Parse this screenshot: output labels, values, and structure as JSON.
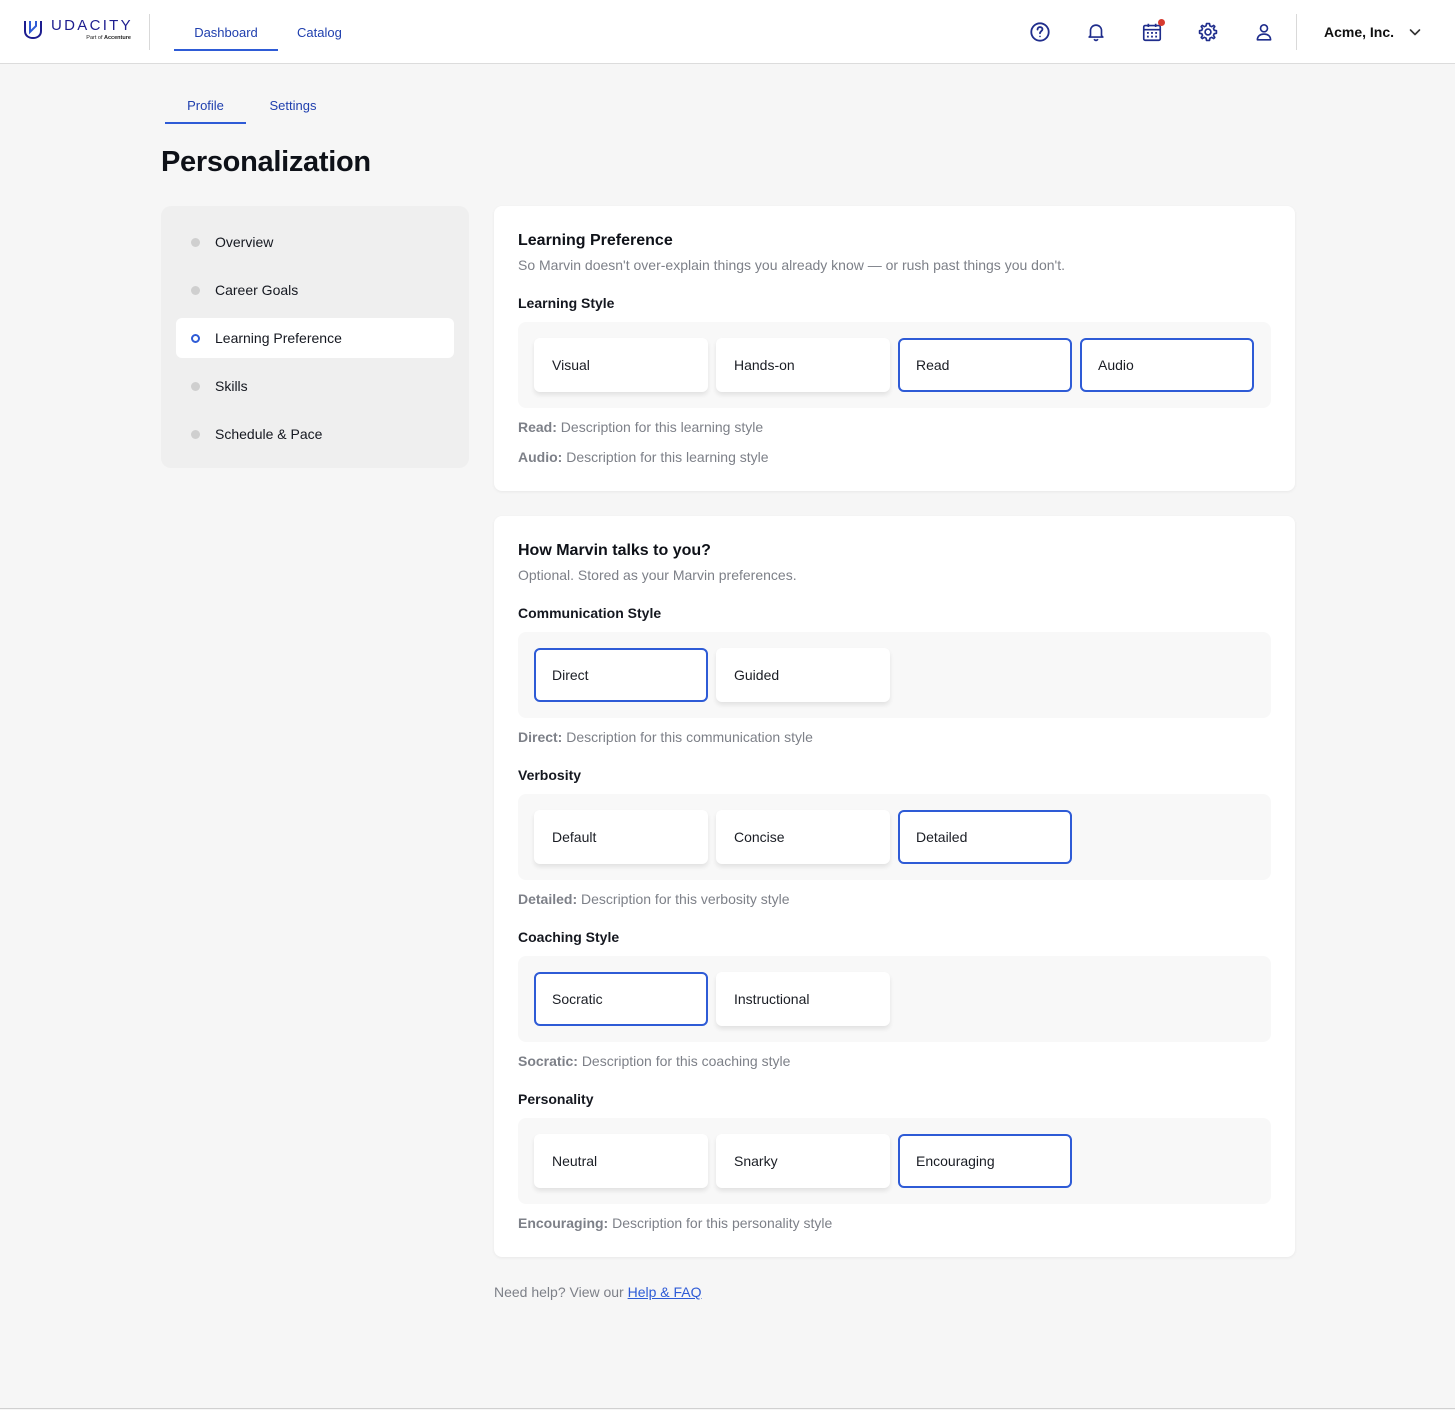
{
  "brand": {
    "name": "UDACITY",
    "sub_prefix": "Part of",
    "sub_company": "Accenture",
    "accent": "#2e5bd6"
  },
  "topnav": {
    "links": [
      {
        "label": "Dashboard",
        "active": true
      },
      {
        "label": "Catalog",
        "active": false
      }
    ],
    "icons": [
      "help-circle-icon",
      "bell-icon",
      "calendar-icon",
      "gear-icon",
      "user-icon"
    ],
    "org_name": "Acme, Inc."
  },
  "subtabs": [
    {
      "label": "Profile",
      "active": true
    },
    {
      "label": "Settings",
      "active": false
    }
  ],
  "page_title": "Personalization",
  "sidenav": {
    "items": [
      {
        "label": "Overview",
        "active": false
      },
      {
        "label": "Career Goals",
        "active": false
      },
      {
        "label": "Learning Preference",
        "active": true
      },
      {
        "label": "Skills",
        "active": false
      },
      {
        "label": "Schedule & Pace",
        "active": false
      }
    ]
  },
  "learning_card": {
    "title": "Learning Preference",
    "subtitle": "So Marvin doesn't over-explain things you already know — or rush past things you don't.",
    "learning_style": {
      "label": "Learning Style",
      "options": [
        {
          "label": "Visual",
          "selected": false
        },
        {
          "label": "Hands-on",
          "selected": false
        },
        {
          "label": "Read",
          "selected": true
        },
        {
          "label": "Audio",
          "selected": true
        }
      ],
      "descriptions": [
        {
          "term": "Read:",
          "text": "Description for this learning style"
        },
        {
          "term": "Audio:",
          "text": "Description for this learning style"
        }
      ]
    }
  },
  "marvin_card": {
    "title": "How Marvin talks to you?",
    "subtitle": "Optional. Stored as your Marvin preferences.",
    "communication": {
      "label": "Communication Style",
      "options": [
        {
          "label": "Direct",
          "selected": true
        },
        {
          "label": "Guided",
          "selected": false
        }
      ],
      "desc_term": "Direct:",
      "desc_text": "Description for this communication style"
    },
    "verbosity": {
      "label": "Verbosity",
      "options": [
        {
          "label": "Default",
          "selected": false
        },
        {
          "label": "Concise",
          "selected": false
        },
        {
          "label": "Detailed",
          "selected": true
        }
      ],
      "desc_term": "Detailed:",
      "desc_text": "Description for this verbosity style"
    },
    "coaching": {
      "label": "Coaching Style",
      "options": [
        {
          "label": "Socratic",
          "selected": true
        },
        {
          "label": "Instructional",
          "selected": false
        }
      ],
      "desc_term": "Socratic:",
      "desc_text": "Description for this coaching style"
    },
    "personality": {
      "label": "Personality",
      "options": [
        {
          "label": "Neutral",
          "selected": false
        },
        {
          "label": "Snarky",
          "selected": false
        },
        {
          "label": "Encouraging",
          "selected": true
        }
      ],
      "desc_term": "Encouraging:",
      "desc_text": "Description for this personality style"
    }
  },
  "footer_help": {
    "text": "Need help? View our",
    "link": "Help & FAQ"
  }
}
